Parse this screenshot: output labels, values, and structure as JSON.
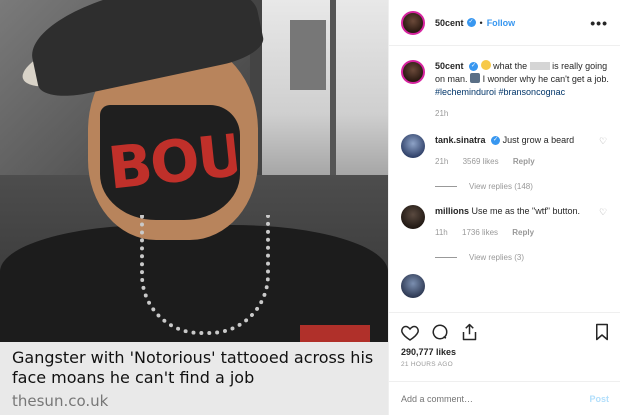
{
  "image": {
    "tattoo_text": "BOUS"
  },
  "caption": {
    "headline": "Gangster with 'Notorious' tattooed across his face moans he can't find a job",
    "source": "thesun.co.uk"
  },
  "header": {
    "username": "50cent",
    "separator": "•",
    "follow_label": "Follow",
    "more_icon": "more-horizontal-icon",
    "more_label": "•••"
  },
  "post_caption": {
    "username": "50cent",
    "text_before": "what the",
    "text_after": "is really going on man.",
    "text_end": "I wonder why he can't get a job.",
    "hashtags": "#lecheminduroi #bransoncognac",
    "age": "21h"
  },
  "comments": [
    {
      "username": "tank.sinatra",
      "text": "Just grow a beard",
      "age": "21h",
      "likes": "3569 likes",
      "reply": "Reply",
      "view_replies": "View replies (148)"
    },
    {
      "username": "millions",
      "text": "Use me as the \"wtf\" button.",
      "age": "11h",
      "likes": "1736 likes",
      "reply": "Reply",
      "view_replies": "View replies (3)"
    }
  ],
  "actions": {
    "like_icon": "heart-icon",
    "comment_icon": "comment-icon",
    "share_icon": "share-icon",
    "save_icon": "bookmark-icon",
    "likes_count": "290,777 likes",
    "timestamp": "21 HOURS AGO"
  },
  "add_comment": {
    "placeholder": "Add a comment…",
    "post_label": "Post"
  },
  "colors": {
    "accent": "#3897f0",
    "post_disabled": "#b2dffc",
    "caption_bg": "#e9e9e9"
  }
}
